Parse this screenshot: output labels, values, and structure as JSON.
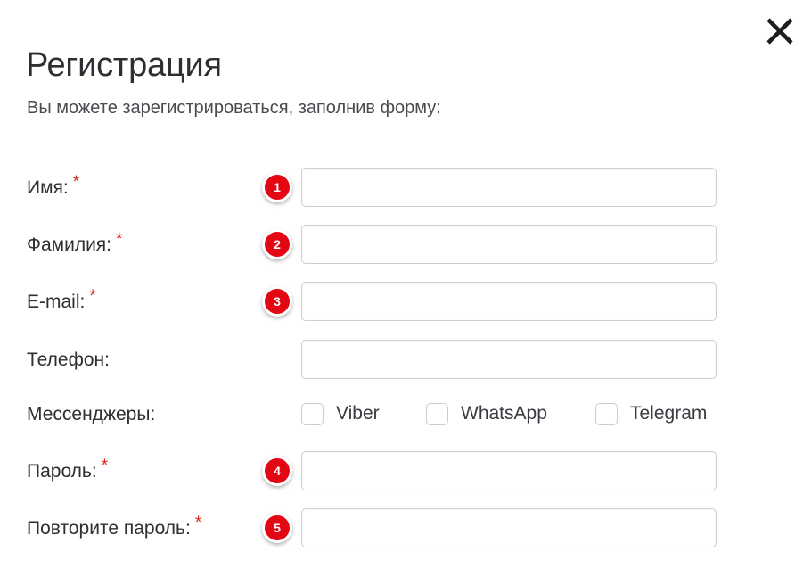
{
  "dialog": {
    "title": "Регистрация",
    "subtitle": "Вы можете зарегистрироваться, заполнив форму:",
    "close_label": "×"
  },
  "colors": {
    "badge_red": "#e30613",
    "required_red": "#e2231a",
    "label_text": "#2e2e33",
    "field_border": "#cfcfcf"
  },
  "form": {
    "rows": [
      {
        "label": "Имя:",
        "required": true,
        "required_mark": "*",
        "badge": "1",
        "type": "text",
        "value": "",
        "placeholder": ""
      },
      {
        "label": "Фамилия:",
        "required": true,
        "required_mark": "*",
        "badge": "2",
        "type": "text",
        "value": "",
        "placeholder": ""
      },
      {
        "label": "E-mail:",
        "required": true,
        "required_mark": "*",
        "badge": "3",
        "type": "text",
        "value": "",
        "placeholder": ""
      },
      {
        "label": "Телефон:",
        "required": false,
        "required_mark": "",
        "badge": "",
        "type": "text",
        "value": "",
        "placeholder": ""
      },
      {
        "label": "Мессенджеры:",
        "required": false,
        "required_mark": "",
        "badge": "",
        "type": "checkboxes",
        "options": [
          {
            "label": "Viber",
            "checked": false
          },
          {
            "label": "WhatsApp",
            "checked": false
          },
          {
            "label": "Telegram",
            "checked": false
          }
        ]
      },
      {
        "label": "Пароль:",
        "required": true,
        "required_mark": "*",
        "badge": "4",
        "type": "password",
        "value": "",
        "placeholder": ""
      },
      {
        "label": "Повторите пароль:",
        "required": true,
        "required_mark": "*",
        "badge": "5",
        "type": "password",
        "value": "",
        "placeholder": ""
      }
    ]
  }
}
